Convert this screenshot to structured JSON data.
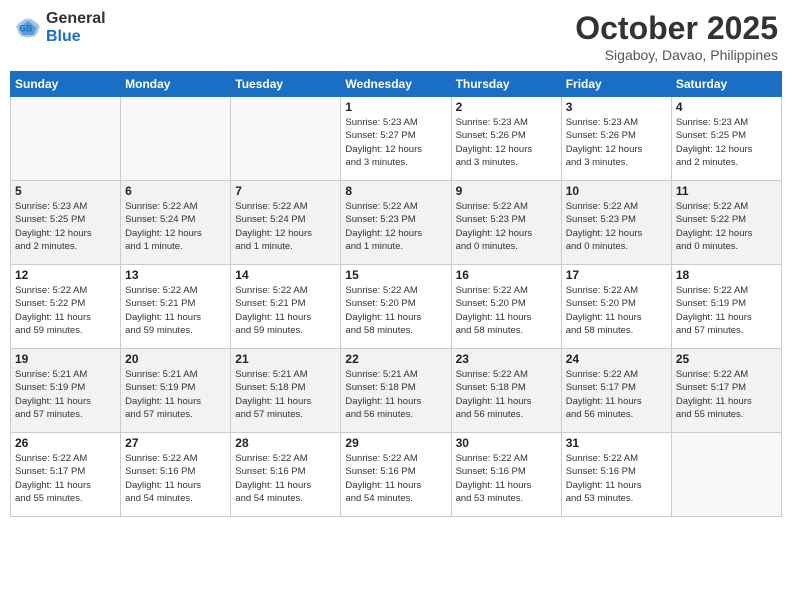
{
  "header": {
    "logo_general": "General",
    "logo_blue": "Blue",
    "title": "October 2025",
    "subtitle": "Sigaboy, Davao, Philippines"
  },
  "days_of_week": [
    "Sunday",
    "Monday",
    "Tuesday",
    "Wednesday",
    "Thursday",
    "Friday",
    "Saturday"
  ],
  "weeks": [
    [
      {
        "day": "",
        "info": ""
      },
      {
        "day": "",
        "info": ""
      },
      {
        "day": "",
        "info": ""
      },
      {
        "day": "1",
        "info": "Sunrise: 5:23 AM\nSunset: 5:27 PM\nDaylight: 12 hours\nand 3 minutes."
      },
      {
        "day": "2",
        "info": "Sunrise: 5:23 AM\nSunset: 5:26 PM\nDaylight: 12 hours\nand 3 minutes."
      },
      {
        "day": "3",
        "info": "Sunrise: 5:23 AM\nSunset: 5:26 PM\nDaylight: 12 hours\nand 3 minutes."
      },
      {
        "day": "4",
        "info": "Sunrise: 5:23 AM\nSunset: 5:25 PM\nDaylight: 12 hours\nand 2 minutes."
      }
    ],
    [
      {
        "day": "5",
        "info": "Sunrise: 5:23 AM\nSunset: 5:25 PM\nDaylight: 12 hours\nand 2 minutes."
      },
      {
        "day": "6",
        "info": "Sunrise: 5:22 AM\nSunset: 5:24 PM\nDaylight: 12 hours\nand 1 minute."
      },
      {
        "day": "7",
        "info": "Sunrise: 5:22 AM\nSunset: 5:24 PM\nDaylight: 12 hours\nand 1 minute."
      },
      {
        "day": "8",
        "info": "Sunrise: 5:22 AM\nSunset: 5:23 PM\nDaylight: 12 hours\nand 1 minute."
      },
      {
        "day": "9",
        "info": "Sunrise: 5:22 AM\nSunset: 5:23 PM\nDaylight: 12 hours\nand 0 minutes."
      },
      {
        "day": "10",
        "info": "Sunrise: 5:22 AM\nSunset: 5:23 PM\nDaylight: 12 hours\nand 0 minutes."
      },
      {
        "day": "11",
        "info": "Sunrise: 5:22 AM\nSunset: 5:22 PM\nDaylight: 12 hours\nand 0 minutes."
      }
    ],
    [
      {
        "day": "12",
        "info": "Sunrise: 5:22 AM\nSunset: 5:22 PM\nDaylight: 11 hours\nand 59 minutes."
      },
      {
        "day": "13",
        "info": "Sunrise: 5:22 AM\nSunset: 5:21 PM\nDaylight: 11 hours\nand 59 minutes."
      },
      {
        "day": "14",
        "info": "Sunrise: 5:22 AM\nSunset: 5:21 PM\nDaylight: 11 hours\nand 59 minutes."
      },
      {
        "day": "15",
        "info": "Sunrise: 5:22 AM\nSunset: 5:20 PM\nDaylight: 11 hours\nand 58 minutes."
      },
      {
        "day": "16",
        "info": "Sunrise: 5:22 AM\nSunset: 5:20 PM\nDaylight: 11 hours\nand 58 minutes."
      },
      {
        "day": "17",
        "info": "Sunrise: 5:22 AM\nSunset: 5:20 PM\nDaylight: 11 hours\nand 58 minutes."
      },
      {
        "day": "18",
        "info": "Sunrise: 5:22 AM\nSunset: 5:19 PM\nDaylight: 11 hours\nand 57 minutes."
      }
    ],
    [
      {
        "day": "19",
        "info": "Sunrise: 5:21 AM\nSunset: 5:19 PM\nDaylight: 11 hours\nand 57 minutes."
      },
      {
        "day": "20",
        "info": "Sunrise: 5:21 AM\nSunset: 5:19 PM\nDaylight: 11 hours\nand 57 minutes."
      },
      {
        "day": "21",
        "info": "Sunrise: 5:21 AM\nSunset: 5:18 PM\nDaylight: 11 hours\nand 57 minutes."
      },
      {
        "day": "22",
        "info": "Sunrise: 5:21 AM\nSunset: 5:18 PM\nDaylight: 11 hours\nand 56 minutes."
      },
      {
        "day": "23",
        "info": "Sunrise: 5:22 AM\nSunset: 5:18 PM\nDaylight: 11 hours\nand 56 minutes."
      },
      {
        "day": "24",
        "info": "Sunrise: 5:22 AM\nSunset: 5:17 PM\nDaylight: 11 hours\nand 56 minutes."
      },
      {
        "day": "25",
        "info": "Sunrise: 5:22 AM\nSunset: 5:17 PM\nDaylight: 11 hours\nand 55 minutes."
      }
    ],
    [
      {
        "day": "26",
        "info": "Sunrise: 5:22 AM\nSunset: 5:17 PM\nDaylight: 11 hours\nand 55 minutes."
      },
      {
        "day": "27",
        "info": "Sunrise: 5:22 AM\nSunset: 5:16 PM\nDaylight: 11 hours\nand 54 minutes."
      },
      {
        "day": "28",
        "info": "Sunrise: 5:22 AM\nSunset: 5:16 PM\nDaylight: 11 hours\nand 54 minutes."
      },
      {
        "day": "29",
        "info": "Sunrise: 5:22 AM\nSunset: 5:16 PM\nDaylight: 11 hours\nand 54 minutes."
      },
      {
        "day": "30",
        "info": "Sunrise: 5:22 AM\nSunset: 5:16 PM\nDaylight: 11 hours\nand 53 minutes."
      },
      {
        "day": "31",
        "info": "Sunrise: 5:22 AM\nSunset: 5:16 PM\nDaylight: 11 hours\nand 53 minutes."
      },
      {
        "day": "",
        "info": ""
      }
    ]
  ]
}
